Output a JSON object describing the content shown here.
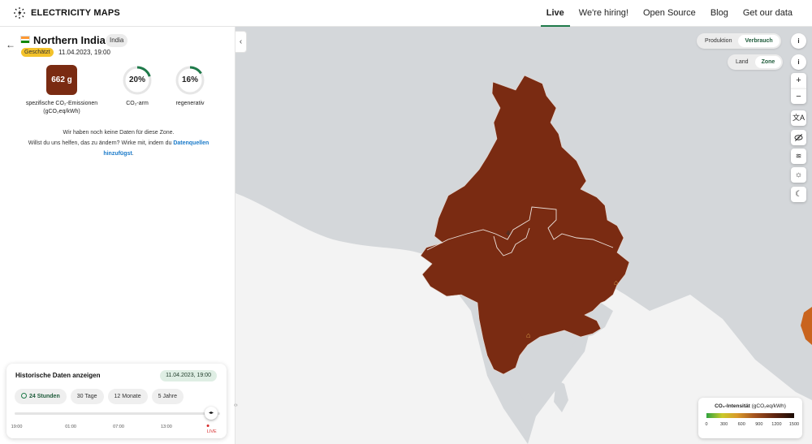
{
  "header": {
    "logo_text": "ELECTRICITY MAPS",
    "nav": [
      "Live",
      "We're hiring!",
      "Open Source",
      "Blog",
      "Get our data"
    ],
    "active_nav": "Live"
  },
  "zone": {
    "name": "Northern India",
    "country": "India",
    "estimated_badge": "Geschätzt",
    "timestamp": "11.04.2023, 19:00"
  },
  "metrics": {
    "carbon_value": "662 g",
    "carbon_label_1": "spezifische CO₂-Emissionen",
    "carbon_label_2": "(gCO₂eq/kWh)",
    "low_carbon_value": "20%",
    "low_carbon_label": "CO₂-arm",
    "low_carbon_fraction": 0.2,
    "renewable_value": "16%",
    "renewable_label": "regenerativ",
    "renewable_fraction": 0.16
  },
  "nodata": {
    "line1": "Wir haben noch keine Daten für diese Zone.",
    "line2": "Willst du uns helfen, das zu ändern? Wirke mit, indem du",
    "link1": "Datenquellen",
    "link2": "hinzufügst",
    "end": "."
  },
  "history": {
    "title": "Historische Daten anzeigen",
    "date": "11.04.2023, 19:00",
    "tabs": [
      "24 Stunden",
      "30 Tage",
      "12 Monate",
      "5 Jahre"
    ],
    "active_tab": "24 Stunden",
    "ticks": [
      "19:00",
      "01:00",
      "07:00",
      "13:00",
      "LIVE"
    ],
    "slider_position": 1.0
  },
  "map_controls": {
    "mode_options": [
      "Produktion",
      "Verbrauch"
    ],
    "mode_selected": "Verbrauch",
    "scope_options": [
      "Land",
      "Zone"
    ],
    "scope_selected": "Zone",
    "info_glyph": "i",
    "zoom_in": "+",
    "zoom_out": "−",
    "icons": [
      "translate-icon",
      "eye-off-icon",
      "wind-icon",
      "sun-icon",
      "moon-icon"
    ]
  },
  "legend": {
    "title": "CO₂-Intensität",
    "unit": "(gCO₂eq/kWh)",
    "ticks": [
      "0",
      "300",
      "600",
      "900",
      "1200",
      "1500"
    ]
  },
  "colors": {
    "brand_green": "#1f7a4a",
    "zone_fill": "#7a2b12",
    "badge_yellow": "#f3c22a",
    "ocean": "#f3f3f3",
    "land": "#d4d7da"
  }
}
